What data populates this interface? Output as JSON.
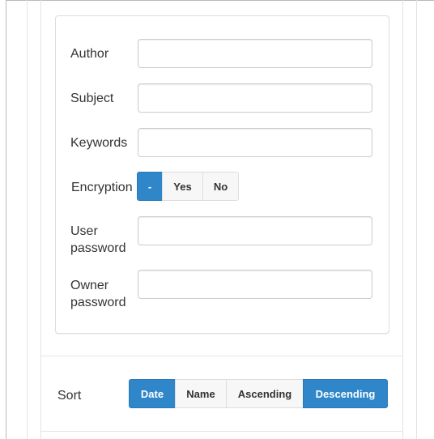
{
  "form": {
    "author": {
      "label": "Author",
      "value": ""
    },
    "subject": {
      "label": "Subject",
      "value": ""
    },
    "keywords": {
      "label": "Keywords",
      "value": ""
    },
    "encryption": {
      "label": "Encryption",
      "options": [
        "-",
        "Yes",
        "No"
      ],
      "selected": "-"
    },
    "user_password": {
      "label_line1": "User",
      "label_line2": "password",
      "value": ""
    },
    "owner_password": {
      "label_line1": "Owner",
      "label_line2": "password",
      "value": ""
    }
  },
  "sort": {
    "label": "Sort",
    "field_options": [
      "Date",
      "Name"
    ],
    "field_selected": "Date",
    "order_options": [
      "Ascending",
      "Descending"
    ],
    "order_selected": "Descending"
  },
  "colors": {
    "accent": "#2f86c8",
    "border": "#dddddd",
    "text": "#333333"
  }
}
